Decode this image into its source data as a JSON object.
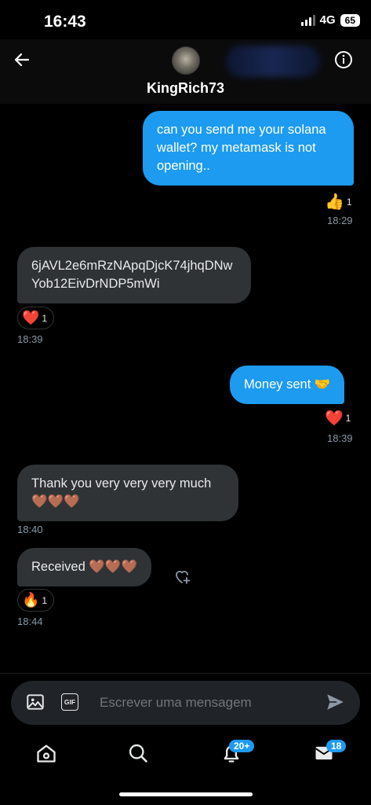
{
  "status": {
    "time": "16:43",
    "network": "4G",
    "battery": "65"
  },
  "header": {
    "title": "KingRich73"
  },
  "messages": [
    {
      "text": "can you send me your solana wallet? my metamask is not opening..",
      "reaction": "👍",
      "reaction_count": "1",
      "time": "18:29"
    },
    {
      "text": "6jAVL2e6mRzNApqDjcK74jhqDNwYob12EivDrNDP5mWi",
      "reaction": "❤️",
      "reaction_count": "1",
      "time": "18:39"
    },
    {
      "text": "Money sent 🤝",
      "reaction": "❤️",
      "reaction_count": "1",
      "time": "18:39"
    },
    {
      "text": "Thank you very very very much 🤎🤎🤎",
      "time": "18:40"
    },
    {
      "text": "Received 🤎🤎🤎",
      "reaction": "🔥",
      "reaction_count": "1",
      "time": "18:44"
    }
  ],
  "composer": {
    "placeholder": "Escrever uma mensagem",
    "gif_label": "GIF"
  },
  "nav": {
    "notifications_badge": "20+",
    "messages_badge": "18"
  }
}
